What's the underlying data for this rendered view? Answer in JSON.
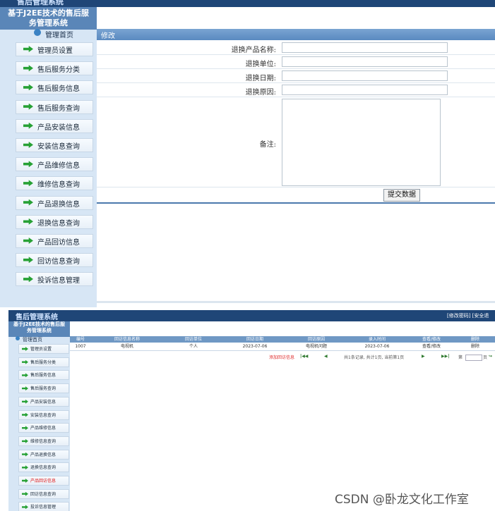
{
  "app": {
    "brand_top": "售后管理系统",
    "brand_line1": "基于J2EE技术的售后服",
    "brand_line2": "务管理系统",
    "home_label": "管理首页"
  },
  "top_window": {
    "menu": [
      {
        "label": "管理员设置"
      },
      {
        "label": "售后服务分类"
      },
      {
        "label": "售后服务信息"
      },
      {
        "label": "售后服务查询"
      },
      {
        "label": "产品安装信息"
      },
      {
        "label": "安装信息查询"
      },
      {
        "label": "产品维修信息"
      },
      {
        "label": "维修信息查询"
      },
      {
        "label": "产品退换信息"
      },
      {
        "label": "退换信息查询"
      },
      {
        "label": "产品回访信息"
      },
      {
        "label": "回访信息查询"
      },
      {
        "label": "投诉信息管理"
      }
    ],
    "section_title": "修改",
    "form": {
      "product_name_label": "退换产品名称:",
      "product_name_value": "",
      "unit_label": "退换单位:",
      "unit_value": "",
      "date_label": "退换日期:",
      "date_value": "",
      "reason_label": "退换原因:",
      "reason_value": "",
      "remarks_label": "备注:",
      "remarks_value": "",
      "submit_label": "提交数据"
    }
  },
  "bottom_window": {
    "brand_top": "售后管理系统",
    "brand_line1": "基于J2EE技术的售后服",
    "brand_line2": "务管理系统",
    "top_links": "[修改密码] [安全退",
    "home_label": "管理首页",
    "menu": [
      {
        "label": "管理员设置",
        "active": false
      },
      {
        "label": "售后服务分类",
        "active": false
      },
      {
        "label": "售后服务信息",
        "active": false
      },
      {
        "label": "售后服务查询",
        "active": false
      },
      {
        "label": "产品安装信息",
        "active": false
      },
      {
        "label": "安装信息查询",
        "active": false
      },
      {
        "label": "产品维修信息",
        "active": false
      },
      {
        "label": "维修信息查询",
        "active": false
      },
      {
        "label": "产品退换信息",
        "active": false
      },
      {
        "label": "退换信息查询",
        "active": false
      },
      {
        "label": "产品回访信息",
        "active": true
      },
      {
        "label": "回访信息查询",
        "active": false
      },
      {
        "label": "投诉信息管理",
        "active": false
      }
    ],
    "table": {
      "columns": [
        "编号",
        "回访信息名称",
        "回访单位",
        "回访日期",
        "回访原因",
        "录入时间",
        "查看/修改",
        "删除"
      ],
      "rows": [
        [
          "1007",
          "电视机",
          "个人",
          "2023-07-06",
          "电视机问题",
          "2023-07-06",
          "查看/修改",
          "删除"
        ]
      ]
    },
    "pager": {
      "add_link": "添加回访信息",
      "first_icon": "first-page-icon",
      "prev_icon": "prev-page-icon",
      "summary": "共1条记录, 共计1页, 当前第1页",
      "next_icon": "next-page-icon",
      "last_icon": "last-page-icon",
      "goto_prefix": "第",
      "goto_suffix": "页",
      "goto_value": ""
    }
  },
  "watermark": "CSDN @卧龙文化工作室",
  "colors": {
    "topbar": "#1f4677",
    "left_panel": "#d7e6f5",
    "section_title": "#6a95c6",
    "menu_arrow": "#27a135",
    "active_menu": "#e01919"
  }
}
